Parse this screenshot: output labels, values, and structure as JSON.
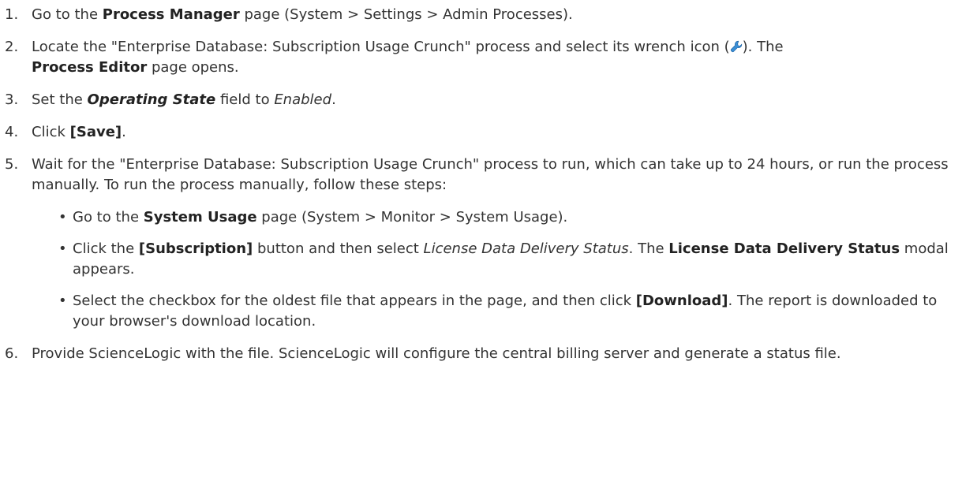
{
  "steps": [
    {
      "num": "1.",
      "t1": "Go to the ",
      "b1": "Process Manager",
      "t2": " page (System > Settings > Admin Processes)."
    },
    {
      "num": "2.",
      "t1": "Locate the \"Enterprise Database: Subscription Usage Crunch\" process and select its wrench icon (",
      "icon": "wrench-icon",
      "t2": "). The",
      "b1": "Process Editor",
      "t3": " page opens."
    },
    {
      "num": "3.",
      "t1": "Set the ",
      "bi1": "Operating State",
      "t2": " field to ",
      "i1": "Enabled",
      "t3": "."
    },
    {
      "num": "4.",
      "t1": "Click ",
      "b1": "[Save]",
      "t2": "."
    },
    {
      "num": "5.",
      "t1": "Wait for the \"Enterprise Database: Subscription Usage Crunch\" process to run, which can take up to 24 hours, or run the process manually. To run the process manually, follow these steps:",
      "bullets": [
        {
          "t1": "Go to the ",
          "b1": "System Usage",
          "t2": " page (System > Monitor > System Usage)."
        },
        {
          "t1": "Click the ",
          "b1": "[Subscription]",
          "t2": " button and then select ",
          "i1": "License Data Delivery Status",
          "t3": ". The ",
          "b2": "License Data Delivery Status",
          "t4": " modal appears."
        },
        {
          "t1": "Select the checkbox for the oldest file that appears in the page, and then click ",
          "b1": "[Download]",
          "t2": ". The report is downloaded to your browser's download location."
        }
      ]
    },
    {
      "num": "6.",
      "t1": "Provide ScienceLogic with the file. ScienceLogic will configure the central billing server and generate a status file."
    }
  ],
  "colors": {
    "text": "#333333",
    "wrench": "#3a8fd6"
  }
}
